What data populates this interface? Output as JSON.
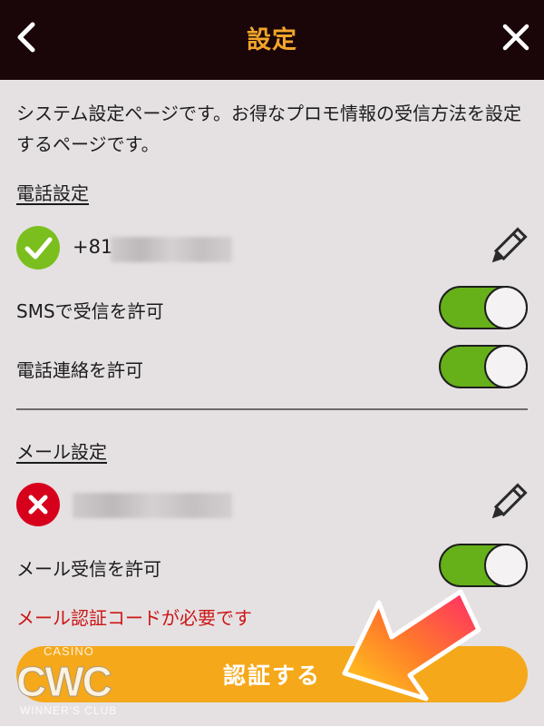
{
  "header": {
    "title": "設定",
    "back_icon": "chevron-left-icon",
    "close_icon": "close-icon",
    "background": "#1a0508",
    "title_color": "#f2a52b"
  },
  "intro": "システム設定ページです。お得なプロモ情報の受信方法を設定するページです。",
  "phone_section": {
    "title": "電話設定",
    "status": "verified",
    "number_prefix": "+81",
    "sms_label": "SMSで受信を許可",
    "sms_enabled": true,
    "call_label": "電話連絡を許可",
    "call_enabled": true
  },
  "email_section": {
    "title": "メール設定",
    "status": "unverified",
    "receive_label": "メール受信を許可",
    "receive_enabled": true,
    "warning": "メール認証コードが必要です"
  },
  "verify_button": {
    "label": "認証する",
    "color": "#f5a81a"
  },
  "watermark": {
    "top": "CASINO",
    "main": "CWC",
    "bottom": "WINNER'S CLUB"
  },
  "colors": {
    "toggle_on": "#66b01a",
    "warning": "#cc1616",
    "success": "#7bbf1e",
    "error": "#d7001c"
  }
}
